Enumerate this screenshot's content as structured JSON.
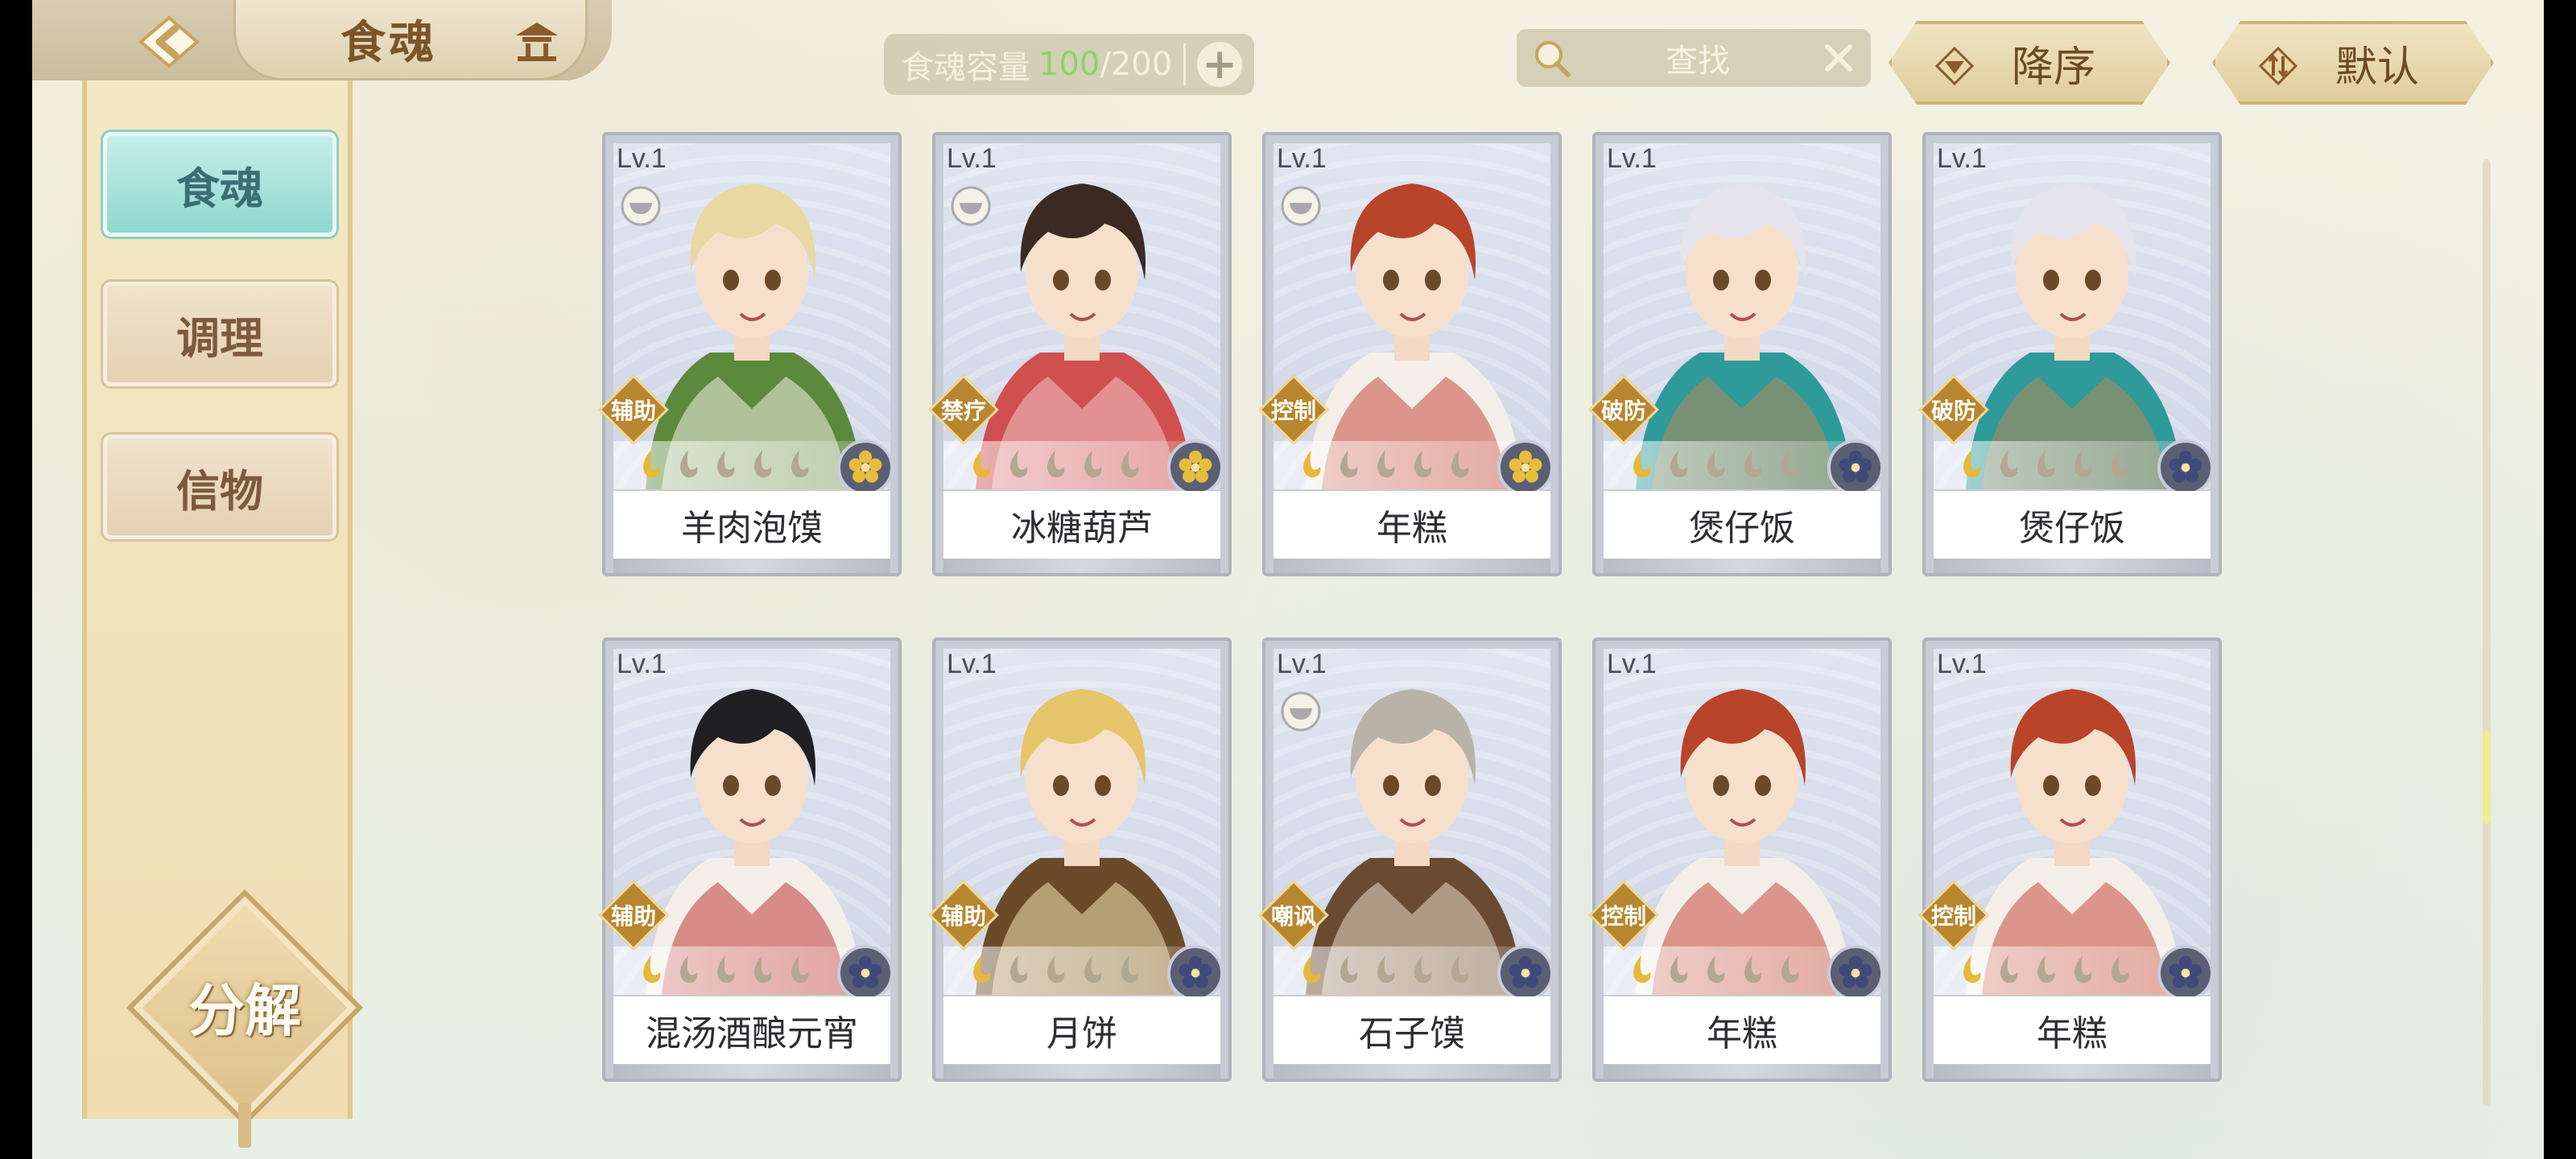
{
  "header": {
    "title": "食魂",
    "back_icon": "back-arrow-icon",
    "home_icon": "pavilion-icon"
  },
  "capacity": {
    "label": "食魂容量",
    "current": "100",
    "separator": "/",
    "max": "200",
    "add_label": "+"
  },
  "search": {
    "label": "查找"
  },
  "sort": {
    "order_label": "降序",
    "mode_label": "默认"
  },
  "sidebar": {
    "items": [
      {
        "label": "食魂",
        "active": true
      },
      {
        "label": "调理",
        "active": false
      },
      {
        "label": "信物",
        "active": false
      }
    ],
    "decompose_label": "分解"
  },
  "cards": [
    {
      "level": "Lv.1",
      "role": "辅助",
      "name": "羊肉泡馍",
      "bowl": true,
      "medal": "gold",
      "palette": [
        "#e9d8a1",
        "#5b8a3c",
        "#f4f0e6"
      ]
    },
    {
      "level": "Lv.1",
      "role": "禁疗",
      "name": "冰糖葫芦",
      "bowl": true,
      "medal": "gold",
      "palette": [
        "#3a2a22",
        "#d05050",
        "#f1c5c9"
      ]
    },
    {
      "level": "Lv.1",
      "role": "控制",
      "name": "年糕",
      "bowl": true,
      "medal": "gold",
      "palette": [
        "#b8442a",
        "#f3efe8",
        "#c94a3d"
      ]
    },
    {
      "level": "Lv.1",
      "role": "破防",
      "name": "煲仔饭",
      "bowl": false,
      "medal": "blue",
      "palette": [
        "#e5e4ec",
        "#2f9a9a",
        "#b48a56"
      ]
    },
    {
      "level": "Lv.1",
      "role": "破防",
      "name": "煲仔饭",
      "bowl": false,
      "medal": "blue",
      "palette": [
        "#e5e4ec",
        "#2f9a9a",
        "#b48a56"
      ]
    },
    {
      "level": "Lv.1",
      "role": "辅助",
      "name": "混汤酒酿元宵",
      "bowl": false,
      "medal": "blue",
      "palette": [
        "#1f1f24",
        "#f3efe8",
        "#c13a3a"
      ]
    },
    {
      "level": "Lv.1",
      "role": "辅助",
      "name": "月饼",
      "bowl": false,
      "medal": "blue",
      "palette": [
        "#e5c46a",
        "#6b4a2a",
        "#f4e3b3"
      ]
    },
    {
      "level": "Lv.1",
      "role": "嘲讽",
      "name": "石子馍",
      "bowl": true,
      "medal": "blue",
      "palette": [
        "#b9b3a7",
        "#6b4a32",
        "#e7dccb"
      ]
    },
    {
      "level": "Lv.1",
      "role": "控制",
      "name": "年糕",
      "bowl": false,
      "medal": "blue",
      "palette": [
        "#b8442a",
        "#f3efe8",
        "#c94a3d"
      ]
    },
    {
      "level": "Lv.1",
      "role": "控制",
      "name": "年糕",
      "bowl": false,
      "medal": "blue",
      "palette": [
        "#b8442a",
        "#f3efe8",
        "#c94a3d"
      ]
    }
  ],
  "colors": {
    "capacity_current": "#8bd36b",
    "accent_gold": "#b8862f",
    "active_tab": "#8fd8cf"
  }
}
